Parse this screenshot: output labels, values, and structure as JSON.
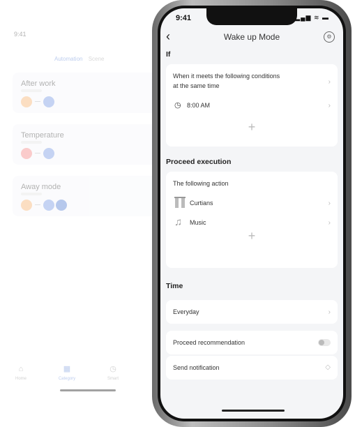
{
  "background_app": {
    "status_time": "9:41",
    "tab_active": "Automation",
    "tab_inactive": "Scene",
    "cards": [
      {
        "title": "After work"
      },
      {
        "title": "Temperature"
      },
      {
        "title": "Away mode"
      }
    ],
    "nav": [
      {
        "label": "Home",
        "icon": "home-icon"
      },
      {
        "label": "Category",
        "icon": "grid-icon"
      },
      {
        "label": "Smart",
        "icon": "clock-icon"
      }
    ]
  },
  "status_bar": {
    "time": "9:41",
    "icons": "signal-wifi-battery"
  },
  "header": {
    "title": "Wake up Mode"
  },
  "if_section": {
    "label": "If",
    "condition_line1": "When it meets the following conditions",
    "condition_line2": "at the same time",
    "time_value": "8:00 AM"
  },
  "execution_section": {
    "label": "Proceed execution",
    "subtitle": "The following action",
    "actions": [
      {
        "label": "Curtians",
        "icon": "curtain-icon"
      },
      {
        "label": "Music",
        "icon": "music-icon"
      }
    ]
  },
  "time_section": {
    "label": "Time",
    "value": "Everyday"
  },
  "options": {
    "recommendation": "Proceed recommendation",
    "notification": "Send notification"
  },
  "colors": {
    "accent_blue": "#6c8fd8",
    "orange_dot": "#f7b77a",
    "pink_dot": "#f58e8e",
    "blue_dot": "#7fa0e6"
  }
}
